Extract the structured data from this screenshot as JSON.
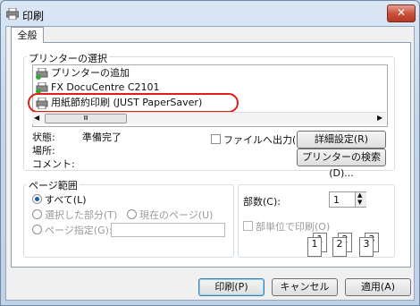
{
  "window": {
    "title": "印刷",
    "close_glyph": "✕"
  },
  "tabs": [
    {
      "label": "全般"
    }
  ],
  "printer_select": {
    "group_label": "プリンターの選択",
    "items": [
      {
        "label": "プリンターの追加",
        "icon": "add-printer-icon"
      },
      {
        "label": "FX DocuCentre C2101",
        "icon": "printer-icon"
      },
      {
        "label": "用紙節約印刷 (JUST PaperSaver)",
        "icon": "printer-icon",
        "selected": true
      }
    ],
    "scroll_thumb": "Ⅲ"
  },
  "status": {
    "state_label": "状態:",
    "state_value": "準備完了",
    "location_label": "場所:",
    "comment_label": "コメント:",
    "print_to_file_label": "ファイルへ出力(F)",
    "details_button": "詳細設定(R)",
    "find_printer_button": "プリンターの検索(D)..."
  },
  "page_range": {
    "group_label": "ページ範囲",
    "all": "すべて(L)",
    "selection": "選択した部分(T)",
    "current_page": "現在のページ(U)",
    "pages": "ページ指定(G):",
    "pages_value": ""
  },
  "copies": {
    "label": "部数(C):",
    "value": "1",
    "collate_label": "部単位で印刷(O)",
    "collate_pages": [
      "1",
      "1",
      "2",
      "2",
      "3",
      "3"
    ]
  },
  "footer": {
    "print_button": "印刷(P)",
    "cancel_button": "キャンセル",
    "apply_button": "適用(A)"
  },
  "colors": {
    "accent": "#1e5ca8",
    "highlight_oval": "#e21b1b",
    "close_red": "#c9523b"
  }
}
